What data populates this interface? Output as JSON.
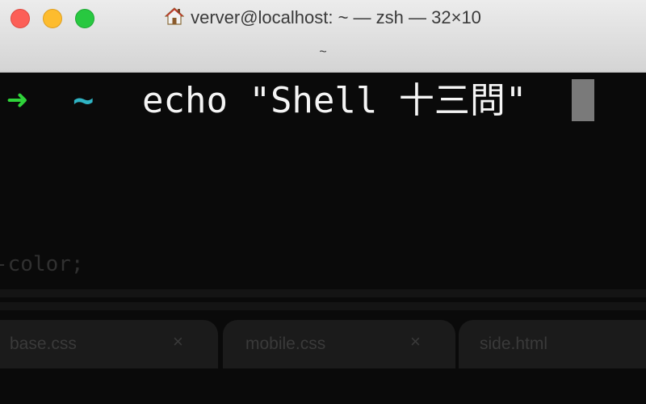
{
  "window": {
    "title": "verver@localhost: ~ — zsh — 32×10",
    "subtitle": "~",
    "icon": "house-icon"
  },
  "terminal": {
    "prompt_arrow": "➜",
    "prompt_dir": "~",
    "command": "echo \"Shell 十三問\"",
    "colors": {
      "arrow": "#2fd33a",
      "dir": "#2fb4c4",
      "text": "#f5f5f5",
      "background": "#0a0a0a"
    }
  },
  "background_editor": {
    "code_fragment": "-color;",
    "tabs": [
      {
        "label": "base.css",
        "close": "×"
      },
      {
        "label": "mobile.css",
        "close": "×"
      },
      {
        "label": "side.html"
      }
    ]
  }
}
